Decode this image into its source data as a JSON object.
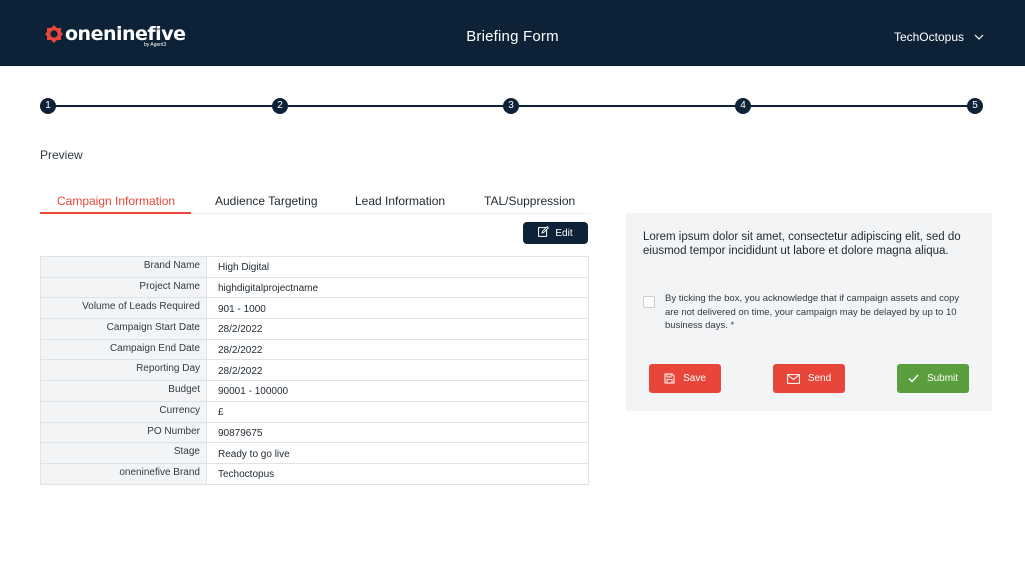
{
  "header": {
    "logo_text": "oneninefive",
    "logo_subtext": "by Agent3",
    "title": "Briefing Form",
    "account_name": "TechOctopus",
    "account_icon": "chevron-down-icon"
  },
  "stepper": {
    "steps": [
      "1",
      "2",
      "3",
      "4",
      "5"
    ]
  },
  "preview_label": "Preview",
  "tabs": [
    {
      "label": "Campaign Information",
      "active": true
    },
    {
      "label": "Audience Targeting",
      "active": false
    },
    {
      "label": "Lead Information",
      "active": false
    },
    {
      "label": "TAL/Suppression",
      "active": false
    }
  ],
  "edit_button": {
    "label": "Edit",
    "icon": "edit-icon"
  },
  "campaign_info": [
    {
      "key": "Brand Name",
      "value": "High Digital"
    },
    {
      "key": "Project Name",
      "value": "highdigitalprojectname"
    },
    {
      "key": "Volume of Leads Required",
      "value": "901 - 1000"
    },
    {
      "key": "Campaign Start Date",
      "value": "28/2/2022"
    },
    {
      "key": "Campaign End Date",
      "value": "28/2/2022"
    },
    {
      "key": "Reporting Day",
      "value": "28/2/2022"
    },
    {
      "key": "Budget",
      "value": "90001 - 100000"
    },
    {
      "key": "Currency",
      "value": "£"
    },
    {
      "key": "PO Number",
      "value": "90879675"
    },
    {
      "key": "Stage",
      "value": "Ready to go live"
    },
    {
      "key": "oneninefive Brand",
      "value": "Techoctopus"
    }
  ],
  "panel": {
    "text": "Lorem ipsum dolor sit amet, consectetur adipiscing elit, sed do eiusmod tempor incididunt ut labore et dolore magna aliqua.",
    "consent_text": "By ticking the box, you acknowledge that if campaign assets and copy are not delivered on time, your campaign may be delayed by up to 10 business days.  *",
    "consent_checked": false,
    "buttons": {
      "save": "Save",
      "send": "Send",
      "submit": "Submit"
    }
  },
  "colors": {
    "header_bg": "#0d2236",
    "accent_red": "#e8463a",
    "submit_green": "#5b9e3e",
    "panel_bg": "#f3f4f5"
  }
}
